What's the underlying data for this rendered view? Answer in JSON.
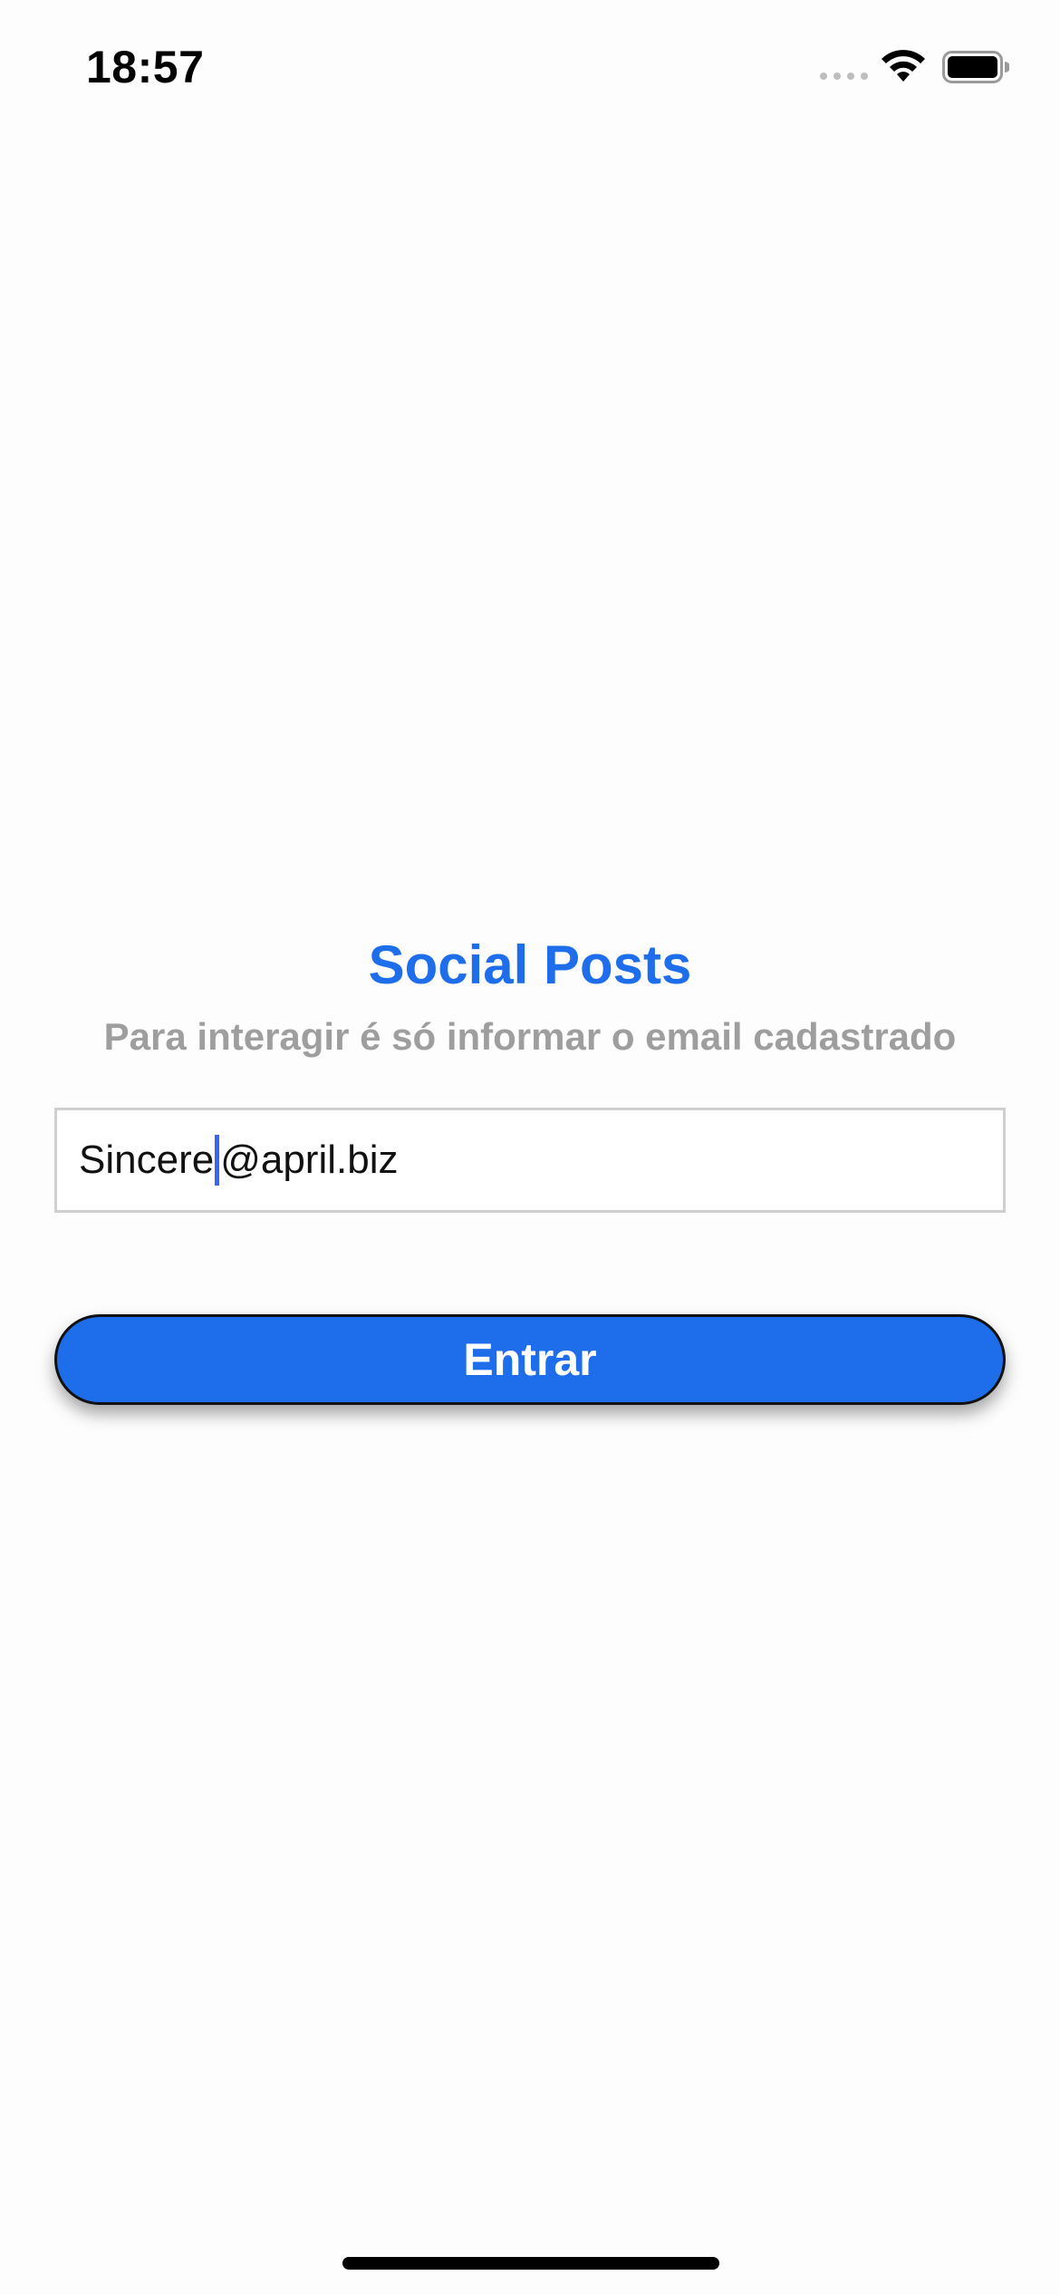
{
  "status_bar": {
    "time": "18:57",
    "icons": [
      "cellular-signal-icon",
      "wifi-icon",
      "battery-icon"
    ]
  },
  "login": {
    "title": "Social Posts",
    "subtitle": "Para interagir é só informar o email cadastrado",
    "email_value_before_caret": "Sincere",
    "email_value_after_caret": "@april.biz",
    "enter_label": "Entrar"
  },
  "colors": {
    "accent": "#1E6DEB",
    "subtitle_gray": "#9E9E9E",
    "caret": "#3D63F0",
    "background": "#FDFDFD"
  }
}
